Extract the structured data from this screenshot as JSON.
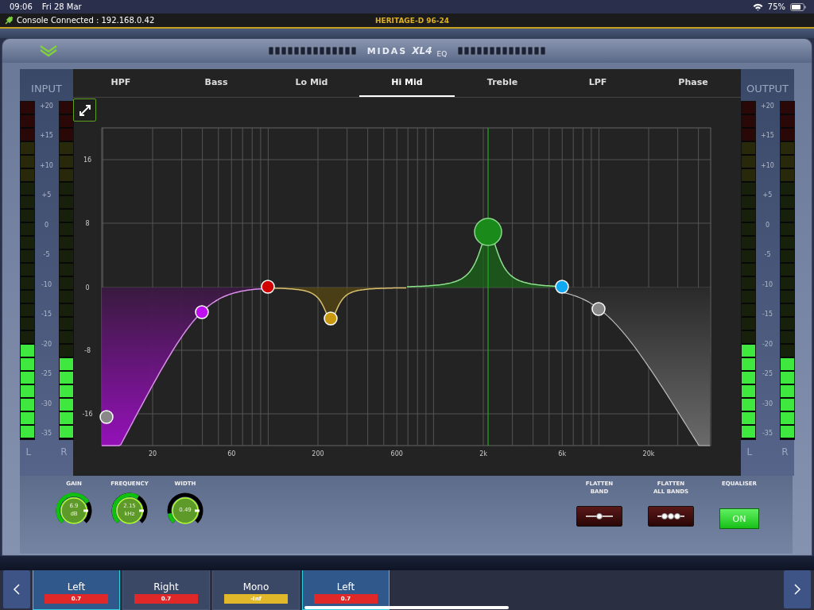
{
  "status_bar": {
    "time": "09:06",
    "date": "Fri 28 Mar",
    "battery": "75%"
  },
  "console_bar": {
    "connection": "Console Connected : 192.168.0.42",
    "console_name": "HERITAGE-D 96-24"
  },
  "eq_panel": {
    "logo": {
      "brand": "MIDAS",
      "model": "XL4",
      "suffix": "EQ"
    },
    "input": {
      "title": "INPUT",
      "scale": [
        "+20",
        "+15",
        "+10",
        "+5",
        "0",
        "-5",
        "-10",
        "-15",
        "-20",
        "-25",
        "-30",
        "-35"
      ],
      "channels": [
        {
          "label": "L",
          "level": 0.28
        },
        {
          "label": "R",
          "level": 0.24
        }
      ]
    },
    "tabs": [
      {
        "label": "HPF",
        "selected": false
      },
      {
        "label": "Bass",
        "selected": false
      },
      {
        "label": "Lo Mid",
        "selected": false
      },
      {
        "label": "Hi Mid",
        "selected": true
      },
      {
        "label": "Treble",
        "selected": false
      },
      {
        "label": "LPF",
        "selected": false
      },
      {
        "label": "Phase",
        "selected": false
      }
    ],
    "graph": {
      "y_labels": [
        "16",
        "8",
        "0",
        "-8",
        "-16"
      ],
      "x_labels": [
        "20",
        "60",
        "200",
        "600",
        "2k",
        "6k",
        "20k"
      ]
    },
    "output": {
      "title": "OUTPUT",
      "scale": [
        "+20",
        "+15",
        "+10",
        "+5",
        "0",
        "-5",
        "-10",
        "-15",
        "-20",
        "-25",
        "-30",
        "-35"
      ],
      "channels": [
        {
          "label": "L",
          "level": 0.28
        },
        {
          "label": "R",
          "level": 0.24
        }
      ]
    },
    "knobs": [
      {
        "label": "GAIN",
        "value": "6.9",
        "unit": "dB",
        "level": 0.72
      },
      {
        "label": "FREQUENCY",
        "value": "2.15",
        "unit": "kHz",
        "level": 0.62
      },
      {
        "label": "WIDTH",
        "value": "0.49",
        "level": 0.13
      }
    ],
    "flatten_buttons": [
      {
        "label": "FLATTEN\nBAND",
        "kind": "single"
      },
      {
        "label": "FLATTEN\nALL BANDS",
        "kind": "all"
      }
    ],
    "equaliser": {
      "label": "EQUALISER",
      "button": "ON",
      "on": true
    }
  },
  "channel_strip": {
    "channels": [
      {
        "name": "Left",
        "value": "0.7",
        "color": "#e02828",
        "selected": true
      },
      {
        "name": "Right",
        "value": "0.7",
        "color": "#e02828",
        "selected": false
      },
      {
        "name": "Mono",
        "value": "-Inf",
        "color": "#e0b82a",
        "selected": false
      },
      {
        "name": "Left",
        "value": "0.7",
        "color": "#e02828",
        "selected": true
      }
    ]
  }
}
